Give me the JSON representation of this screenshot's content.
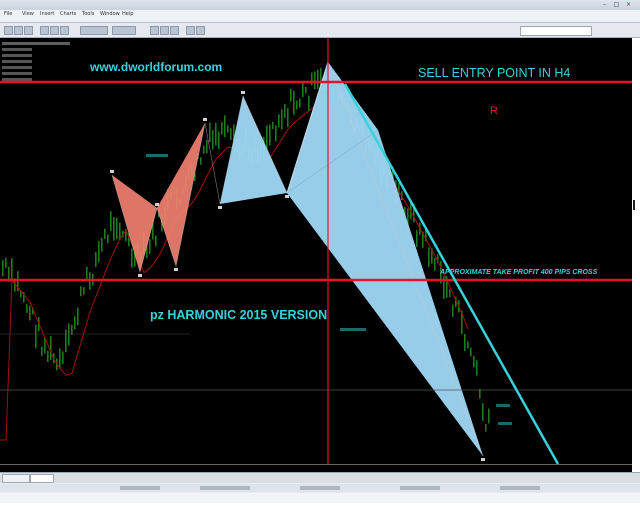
{
  "window": {
    "title": ""
  },
  "menu": {
    "items": [
      "File",
      "View",
      "Insert",
      "Charts",
      "Tools",
      "Window",
      "Help"
    ]
  },
  "chart": {
    "website": "www.dworldforum.com",
    "sell_label": "SELL ENTRY POINT IN H4",
    "tp_label": "APPROXIMATE TAKE PROFIT 400 PIPS CROSS",
    "version_label": "pz HARMONIC 2015 VERSION",
    "marker": "R",
    "colors": {
      "background": "#000000",
      "sell_line": "#e8102a",
      "tp_line": "#e8102a",
      "cursor_line": "#e8102a",
      "bullish_pattern": "#f08070",
      "bearish_pattern": "#9fd8f5",
      "trendline": "#37d2dc",
      "candles": "#1f7a1f",
      "moving_average": "#a01010",
      "label_text": "#37d2dc"
    }
  }
}
